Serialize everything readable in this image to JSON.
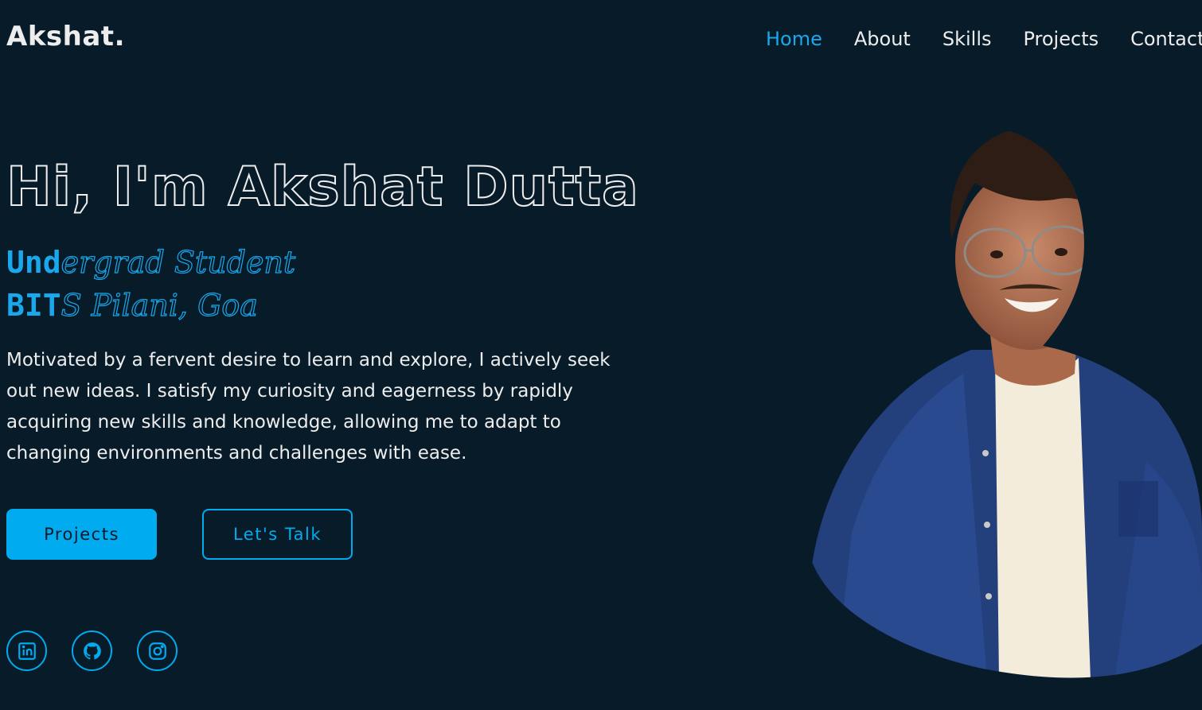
{
  "header": {
    "logo": "Akshat.",
    "nav": [
      {
        "label": "Home",
        "active": true
      },
      {
        "label": "About",
        "active": false
      },
      {
        "label": "Skills",
        "active": false
      },
      {
        "label": "Projects",
        "active": false
      },
      {
        "label": "Contact",
        "active": false
      }
    ]
  },
  "hero": {
    "title": "Hi, I'm Akshat Dutta",
    "subtitle_line1_fill": "Und",
    "subtitle_line1_rest": "ergrad Student",
    "subtitle_line2_fill": "BIT",
    "subtitle_line2_rest": "S Pilani, Goa",
    "description": "Motivated by a fervent desire to learn and explore, I actively seek out new ideas. I satisfy my curiosity and eagerness by rapidly acquiring new skills and knowledge, allowing me to adapt to changing environments and challenges with ease.",
    "buttons": {
      "projects": "Projects",
      "talk": "Let's Talk"
    },
    "socials": [
      "linkedin-icon",
      "github-icon",
      "instagram-icon"
    ]
  },
  "colors": {
    "background": "#081b29",
    "accent": "#00abf0",
    "text": "#ededed"
  }
}
